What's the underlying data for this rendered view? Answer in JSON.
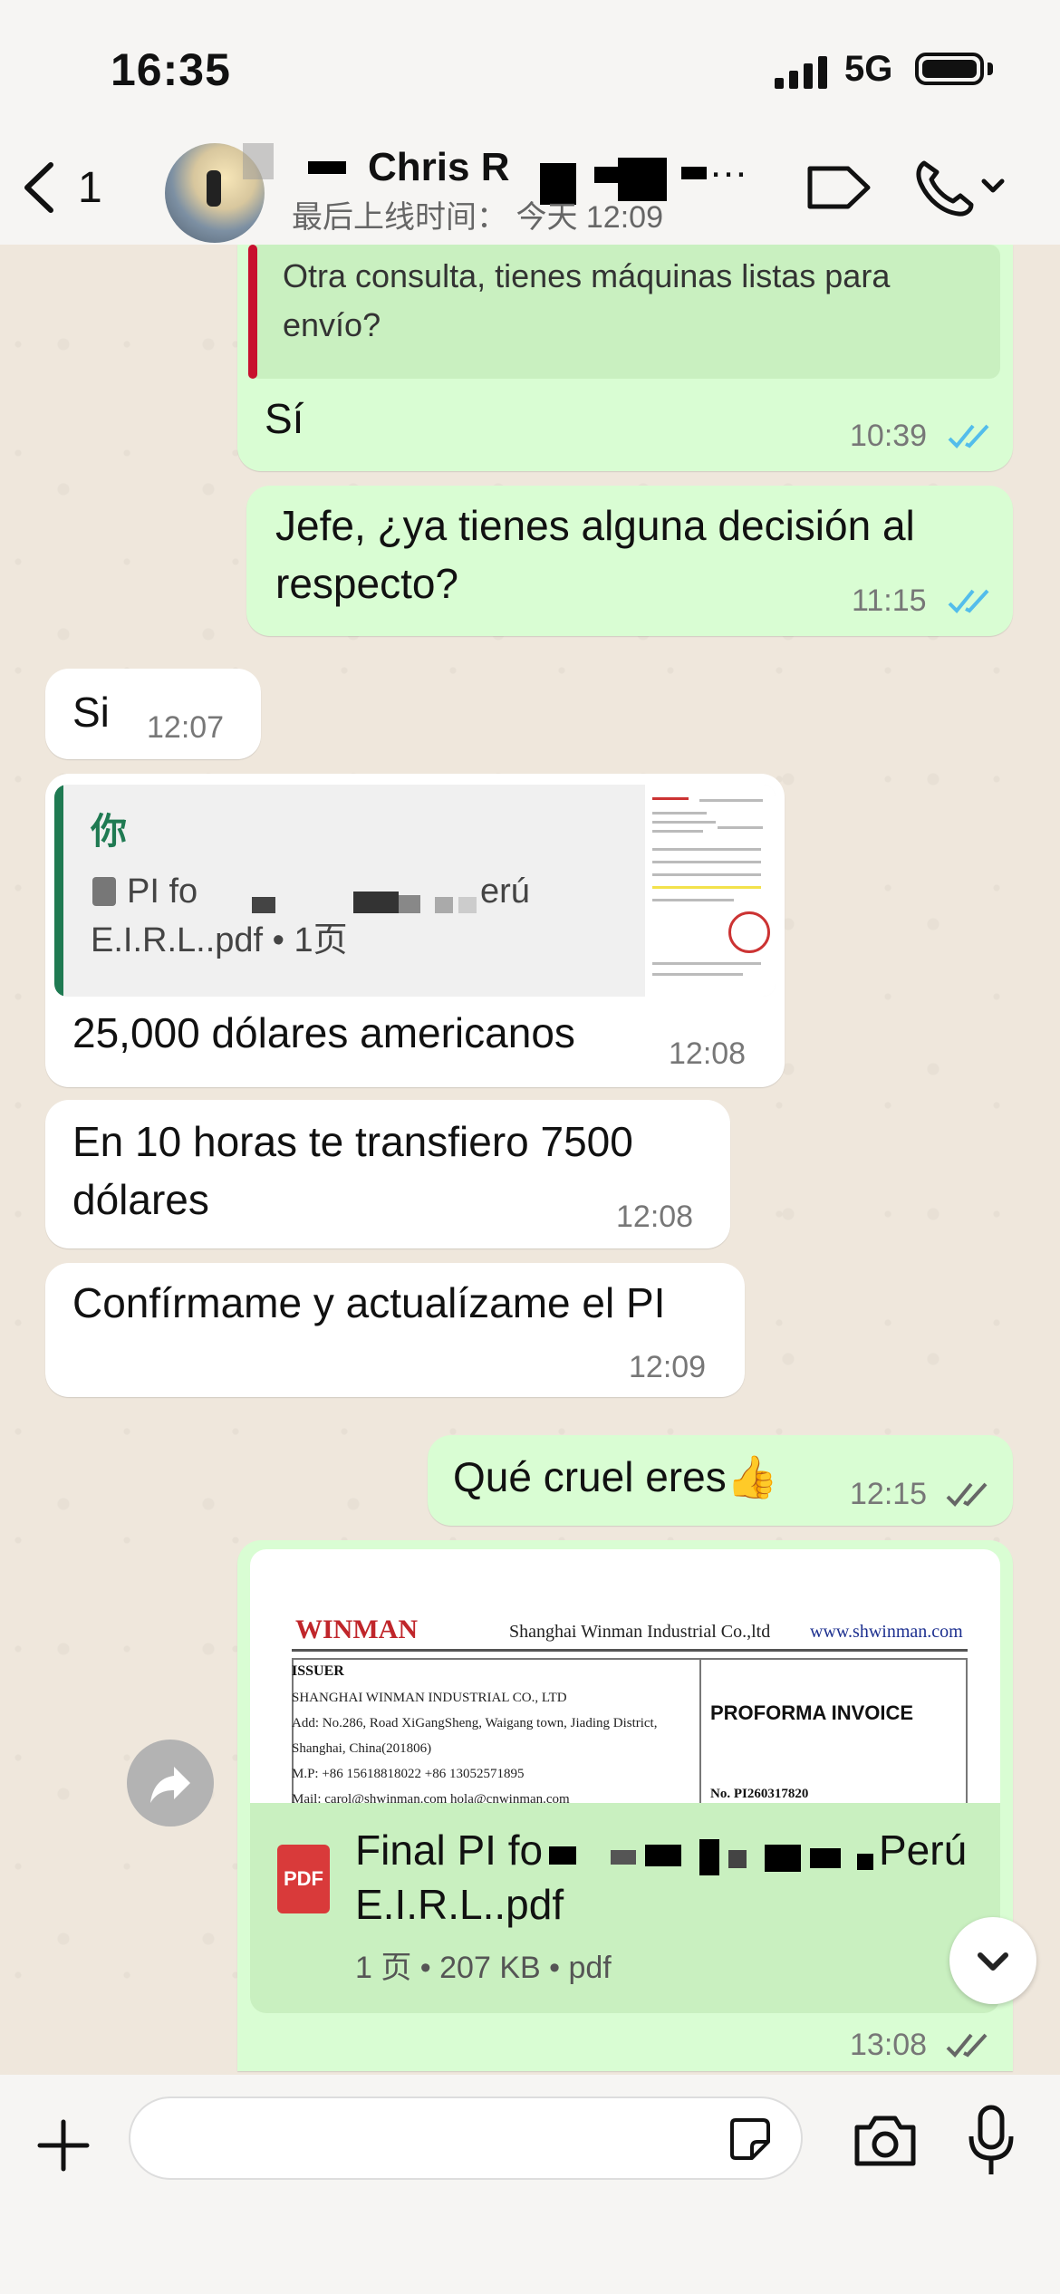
{
  "status_bar": {
    "time": "16:35",
    "network": "5G"
  },
  "header": {
    "back_count": "1",
    "contact_name": "Chris R",
    "more": "…",
    "last_seen": "最后上线时间： 今天 12:09"
  },
  "messages": {
    "m1": {
      "quote_text": "Otra consulta, tienes máquinas listas para envío?",
      "text": "Sí",
      "time": "10:39",
      "status": "read"
    },
    "m2": {
      "text": "Jefe, ¿ya tienes alguna decisión al respecto?",
      "time": "11:15",
      "status": "read"
    },
    "m3": {
      "text": "Si",
      "time": "12:07"
    },
    "m4": {
      "quote_sender": "你",
      "quote_doc_line1": "PI fo",
      "quote_doc_line1_end": "erú",
      "quote_doc_line2": "E.I.R.L..pdf • 1页",
      "text": "25,000 dólares americanos",
      "time": "12:08"
    },
    "m5": {
      "text": "En 10 horas te transfiero 7500 dólares",
      "time": "12:08"
    },
    "m6": {
      "text": "Confírmame y actualízame el PI",
      "time": "12:09"
    },
    "m7": {
      "text": "Qué cruel eres👍",
      "time": "12:15",
      "status": "delivered"
    },
    "m8": {
      "preview": {
        "brand": "WINMAN",
        "company_title": "Shanghai Winman Industrial Co.,ltd",
        "website": "www.shwinman.com",
        "issuer_label": "ISSUER",
        "issuer_name": "SHANGHAI WINMAN INDUSTRIAL CO., LTD",
        "address": "Add: No.286, Road XiGangSheng, Waigang town, Jiading District,",
        "city": "Shanghai, China(201806)",
        "phone": "M.P: +86 15618818022 +86 13052571895",
        "mail": "Mail: carol@shwinman.com    hola@cnwinman.com",
        "doc_type": "PROFORMA INVOICE",
        "number": "No.  PI260317820"
      },
      "file_icon": "PDF",
      "file_name_start": "Final PI fo",
      "file_name_end": "Perú",
      "file_name_line2": "E.I.R.L..pdf",
      "file_meta": "1 页 • 207 KB • pdf",
      "time": "13:08",
      "status": "delivered"
    }
  },
  "icons": {
    "back": "chevron-left-icon",
    "video": "video-call-icon",
    "call": "phone-icon",
    "forward": "forward-icon",
    "scroll": "chevron-down-icon",
    "plus": "plus-icon",
    "sticker": "sticker-icon",
    "camera": "camera-icon",
    "mic": "microphone-icon"
  },
  "colors": {
    "outgoing_bubble": "#d9fdd3",
    "incoming_bubble": "#ffffff",
    "read_ticks": "#53bdeb",
    "quote_bar_red": "#c8102e",
    "quote_bar_green": "#1f7a52",
    "pdf_icon": "#d93a3a"
  }
}
